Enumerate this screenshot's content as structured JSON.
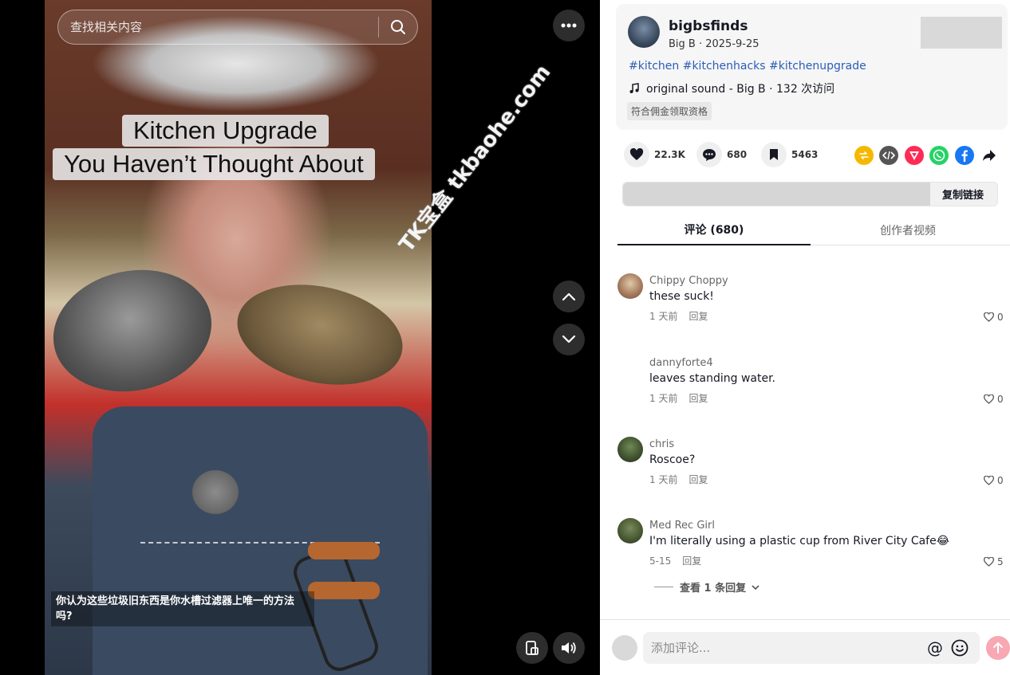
{
  "search": {
    "placeholder": "查找相关内容"
  },
  "video": {
    "overlay_line1": "Kitchen Upgrade",
    "overlay_line2": "You Haven’t Thought About",
    "caption": "你认为这些垃圾旧东西是你水槽过滤器上唯一的方法吗?",
    "watermark": "TK宝盒 tkbaohe.com"
  },
  "post": {
    "author": "bigbsfinds",
    "meta": "Big B · 2025-9-25",
    "hashtags": "#kitchen #kitchenhacks #kitchenupgrade",
    "sound": "original sound - Big B · 132 次访问",
    "badge": "符合佣金领取资格"
  },
  "actions": {
    "likes": "22.3K",
    "comments": "680",
    "saves": "5463",
    "copy_link": "复制链接"
  },
  "share_colors": {
    "repost": "#f5b800",
    "embed": "#555555",
    "send": "#fe2c55",
    "whatsapp": "#25d366",
    "facebook": "#1877f2"
  },
  "tabs": {
    "comments": "评论 (680)",
    "creator_videos": "创作者视频"
  },
  "comments": [
    {
      "user": "Chippy Choppy",
      "text": "these suck!",
      "time": "1 天前",
      "reply": "回复",
      "likes": "0"
    },
    {
      "user": "dannyforte4",
      "text": "leaves standing water.",
      "time": "1 天前",
      "reply": "回复",
      "likes": "0"
    },
    {
      "user": "chris",
      "text": "Roscoe?",
      "time": "1 天前",
      "reply": "回复",
      "likes": "0"
    },
    {
      "user": "Med Rec Girl",
      "text": "I'm literally using a plastic cup from River City Cafe😂",
      "time": "5-15",
      "reply": "回复",
      "likes": "5"
    }
  ],
  "view_replies": "查看 1 条回复",
  "compose": {
    "placeholder": "添加评论..."
  }
}
